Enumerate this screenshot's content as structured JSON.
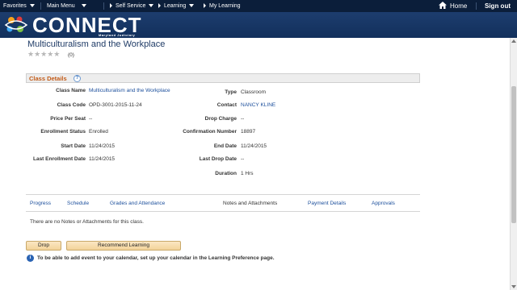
{
  "topbar": {
    "favorites": "Favorites",
    "main_menu": "Main Menu",
    "self_service": "Self Service",
    "learning": "Learning",
    "my_learning": "My Learning",
    "home": "Home",
    "sign_out": "Sign out"
  },
  "brand": {
    "name": "CONNECT",
    "subtitle": "Maryland Judiciary"
  },
  "course": {
    "title": "Multiculturalism and the Workplace",
    "stars": "★★★★★",
    "rating_count": "(0)"
  },
  "class_details": {
    "header": "Class Details",
    "help": "?",
    "labels": {
      "class_name": "Class Name",
      "class_code": "Class Code",
      "price_per_seat": "Price Per Seat",
      "enrollment_status": "Enrollment Status",
      "start_date": "Start Date",
      "last_enrollment_date": "Last Enrollment Date",
      "type": "Type",
      "contact": "Contact",
      "drop_charge": "Drop Charge",
      "confirmation_number": "Confirmation Number",
      "end_date": "End Date",
      "last_drop_date": "Last Drop Date",
      "duration": "Duration"
    },
    "values": {
      "class_name": "Multiculturalism and the Workplace",
      "class_code": "OPD-3001-2015-11-24",
      "price_per_seat": "--",
      "enrollment_status": "Enrolled",
      "start_date": "11/24/2015",
      "last_enrollment_date": "11/24/2015",
      "type": "Classroom",
      "contact": "NANCY KLINE",
      "drop_charge": "--",
      "confirmation_number": "18897",
      "end_date": "11/24/2015",
      "last_drop_date": "--",
      "duration": "1 Hrs"
    }
  },
  "tabs": [
    {
      "label": "Progress"
    },
    {
      "label": "Schedule"
    },
    {
      "label": "Grades and Attendance"
    },
    {
      "label": "Notes and Attachments",
      "active": true
    },
    {
      "label": "Payment Details"
    },
    {
      "label": "Approvals"
    }
  ],
  "notes_message": "There are no Notes or Attachments for this class.",
  "buttons": {
    "drop": "Drop",
    "recommend": "Recommend Learning"
  },
  "info": {
    "icon": "i",
    "text": "To be able to add event to your calendar, set up your calendar in the Learning Preference page."
  },
  "colors": {
    "topbar": "#0b1e3a",
    "banner": "#1d3d6e",
    "section_title": "#c25a17",
    "link": "#1c4f9c"
  }
}
